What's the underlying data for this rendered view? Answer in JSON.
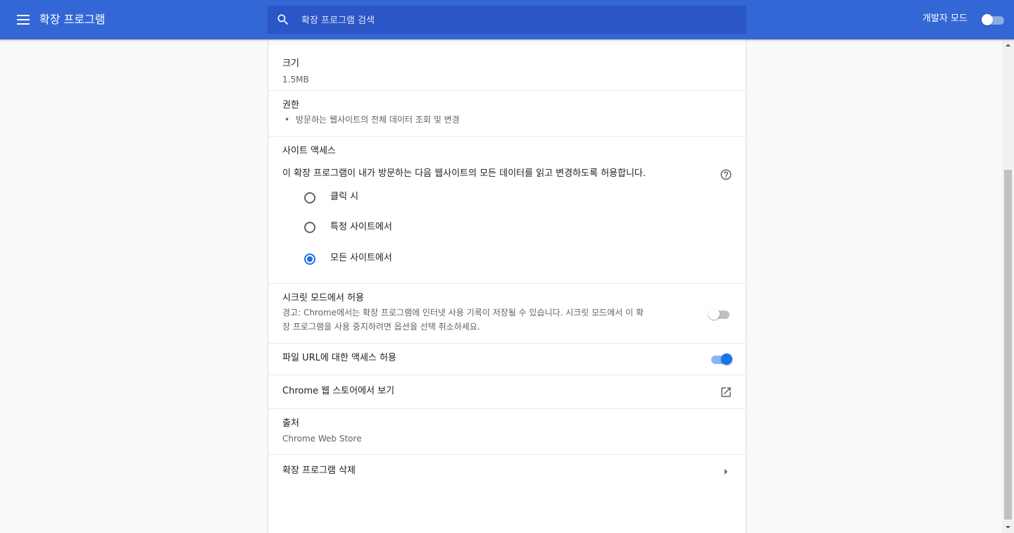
{
  "header": {
    "title": "확장 프로그램",
    "search_placeholder": "확장 프로그램 검색",
    "dev_mode_label": "개발자 모드"
  },
  "details": {
    "size": {
      "label": "크기",
      "value": "1.5MB"
    },
    "permissions": {
      "label": "권한",
      "items": [
        "방문하는 웹사이트의 전체 데이터 조회 및 변경"
      ]
    },
    "site_access": {
      "label": "사이트 액세스",
      "description": "이 확장 프로그램이 내가 방문하는 다음 웹사이트의 모든 데이터를 읽고 변경하도록 허용합니다.",
      "options": [
        {
          "label": "클릭 시",
          "checked": false
        },
        {
          "label": "특정 사이트에서",
          "checked": false
        },
        {
          "label": "모든 사이트에서",
          "checked": true
        }
      ]
    },
    "incognito": {
      "label": "시크릿 모드에서 허용",
      "warning_line1": "경고: Chrome에서는 확장 프로그램에 인터넷 사용 기록이 저장될 수 있습니다. 시크릿 모드에서 이 확",
      "warning_line2": "장 프로그램을 사용 중지하려면 옵션을 선택 취소하세요.",
      "enabled": false
    },
    "file_urls": {
      "label": "파일 URL에 대한 액세스 허용",
      "enabled": true
    },
    "webstore_link": {
      "label": "Chrome 웹 스토어에서 보기"
    },
    "source": {
      "label": "출처",
      "value": "Chrome Web Store"
    },
    "remove": {
      "label": "확장 프로그램 삭제"
    }
  },
  "colors": {
    "header_bg": "#3367d6",
    "search_bg": "#2a56c6",
    "accent": "#1a73e8"
  }
}
